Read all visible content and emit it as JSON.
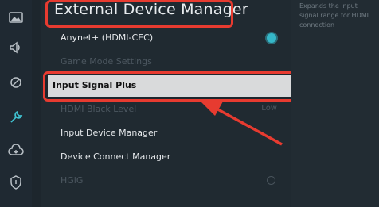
{
  "header": {
    "title": "External Device Manager"
  },
  "menu": {
    "items": [
      {
        "label": "Anynet+ (HDMI-CEC)",
        "value": "",
        "state": "on"
      },
      {
        "label": "Game Mode Settings",
        "value": "",
        "state": ""
      },
      {
        "label": "Input Signal Plus",
        "value": "",
        "state": ""
      },
      {
        "label": "HDMI Black Level",
        "value": "Low",
        "state": ""
      },
      {
        "label": "Input Device Manager",
        "value": "",
        "state": ""
      },
      {
        "label": "Device Connect Manager",
        "value": "",
        "state": ""
      },
      {
        "label": "HGiG",
        "value": "",
        "state": "off"
      }
    ]
  },
  "help": {
    "text": "Expands the input signal range for HDMI connection"
  },
  "sidebar": {
    "icons": [
      "picture-icon",
      "sound-icon",
      "broadcasting-icon",
      "wrench-icon",
      "cloud-support-icon",
      "shield-icon"
    ]
  },
  "colors": {
    "accent": "#e73b30",
    "toggle": "#35b7c8",
    "selected_bg": "#d9dadb"
  }
}
